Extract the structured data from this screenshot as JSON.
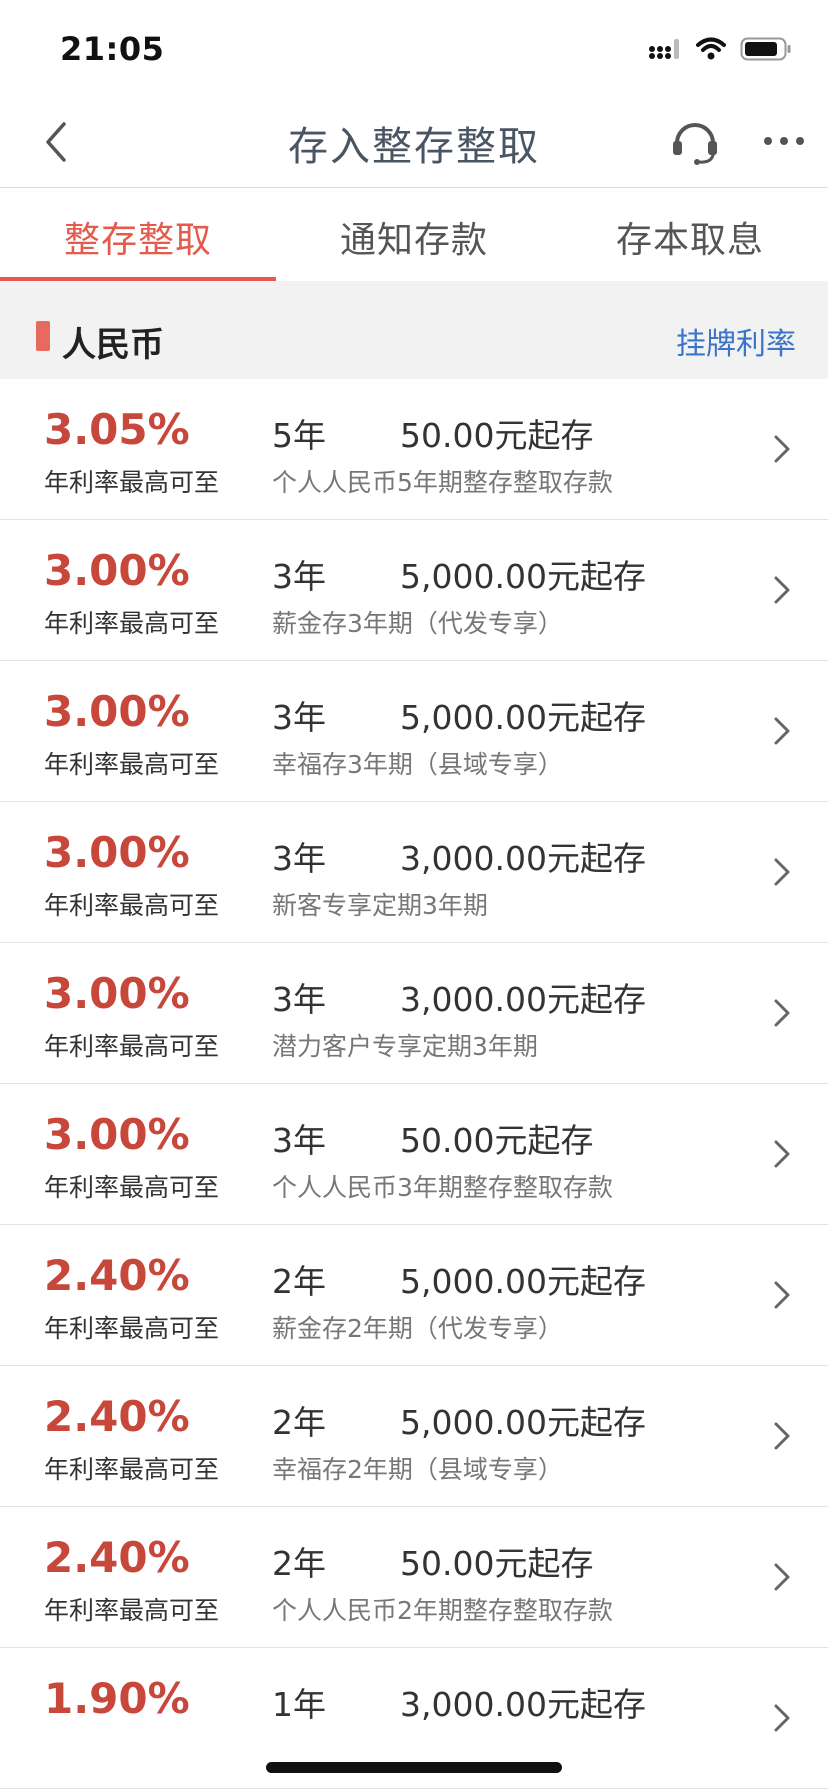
{
  "status_bar": {
    "time": "21:05"
  },
  "nav": {
    "title": "存入整存整取"
  },
  "tabs": [
    {
      "label": "整存整取",
      "active": true
    },
    {
      "label": "通知存款",
      "active": false
    },
    {
      "label": "存本取息",
      "active": false
    }
  ],
  "section": {
    "title": "人民币",
    "link": "挂牌利率"
  },
  "products": [
    {
      "rate": "3.05%",
      "rate_label": "年利率最高可至",
      "term": "5年",
      "min_amount": "50.00元起存",
      "name": "个人人民币5年期整存整取存款"
    },
    {
      "rate": "3.00%",
      "rate_label": "年利率最高可至",
      "term": "3年",
      "min_amount": "5,000.00元起存",
      "name": "薪金存3年期（代发专享）"
    },
    {
      "rate": "3.00%",
      "rate_label": "年利率最高可至",
      "term": "3年",
      "min_amount": "5,000.00元起存",
      "name": "幸福存3年期（县域专享）"
    },
    {
      "rate": "3.00%",
      "rate_label": "年利率最高可至",
      "term": "3年",
      "min_amount": "3,000.00元起存",
      "name": "新客专享定期3年期"
    },
    {
      "rate": "3.00%",
      "rate_label": "年利率最高可至",
      "term": "3年",
      "min_amount": "3,000.00元起存",
      "name": "潜力客户专享定期3年期"
    },
    {
      "rate": "3.00%",
      "rate_label": "年利率最高可至",
      "term": "3年",
      "min_amount": "50.00元起存",
      "name": "个人人民币3年期整存整取存款"
    },
    {
      "rate": "2.40%",
      "rate_label": "年利率最高可至",
      "term": "2年",
      "min_amount": "5,000.00元起存",
      "name": "薪金存2年期（代发专享）"
    },
    {
      "rate": "2.40%",
      "rate_label": "年利率最高可至",
      "term": "2年",
      "min_amount": "5,000.00元起存",
      "name": "幸福存2年期（县域专享）"
    },
    {
      "rate": "2.40%",
      "rate_label": "年利率最高可至",
      "term": "2年",
      "min_amount": "50.00元起存",
      "name": "个人人民币2年期整存整取存款"
    },
    {
      "rate": "1.90%",
      "rate_label": "",
      "term": "1年",
      "min_amount": "3,000.00元起存",
      "name": ""
    }
  ],
  "colors": {
    "accent": "#e45a4c",
    "rate": "#c7473b",
    "link": "#3b74c8",
    "title": "#4a5563"
  },
  "icons": [
    "back-icon",
    "customer-service-icon",
    "more-icon",
    "chevron-right-icon",
    "signal-icon",
    "wifi-icon",
    "battery-icon"
  ]
}
